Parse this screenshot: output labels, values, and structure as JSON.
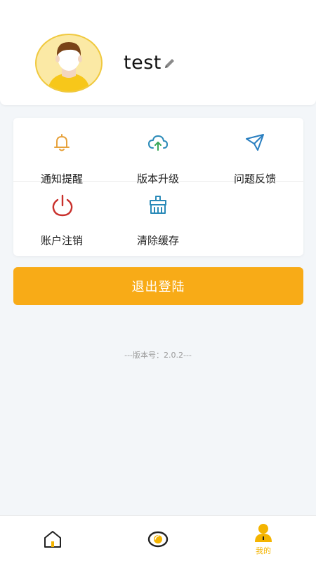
{
  "profile": {
    "username": "test"
  },
  "menu": {
    "items": [
      {
        "label": "通知提醒",
        "icon": "bell-icon",
        "color": "#e7a23c"
      },
      {
        "label": "版本升级",
        "icon": "cloud-upload-icon",
        "color": "#2a8ab8"
      },
      {
        "label": "问题反馈",
        "icon": "paper-plane-icon",
        "color": "#2a7fc0"
      },
      {
        "label": "账户注销",
        "icon": "power-icon",
        "color": "#c9302c"
      },
      {
        "label": "清除缓存",
        "icon": "broom-icon",
        "color": "#2a8ab8"
      }
    ]
  },
  "logout": {
    "label": "退出登陆",
    "color": "#f8ab17"
  },
  "version_text": "---版本号：2.0.2---",
  "tabbar": {
    "tabs": [
      {
        "icon": "home-icon",
        "label": "",
        "active": false
      },
      {
        "icon": "eye-icon",
        "label": "",
        "active": false
      },
      {
        "icon": "user-icon",
        "label": "我的",
        "active": true
      }
    ],
    "active_color": "#f4b400"
  }
}
